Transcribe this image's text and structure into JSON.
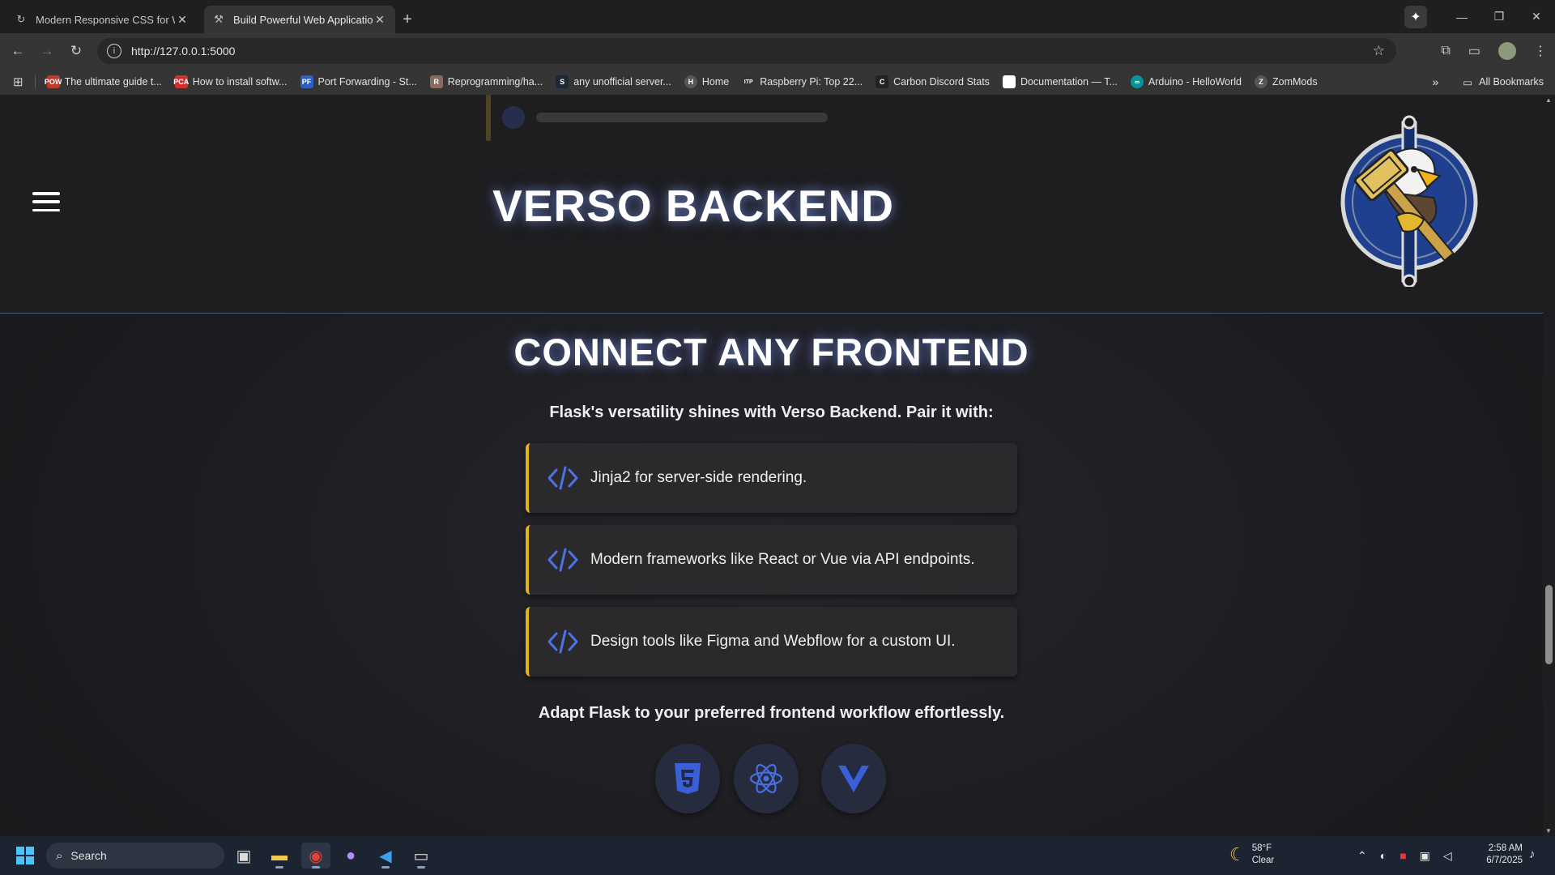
{
  "browser": {
    "tabs": [
      {
        "title": "Modern Responsive CSS for We",
        "active": false
      },
      {
        "title": "Build Powerful Web Application",
        "active": true
      }
    ],
    "new_tab": "+",
    "url": "http://127.0.0.1:5000",
    "bookmarks": [
      {
        "label": "The ultimate guide t...",
        "icon": "POW",
        "color": "#c0392b"
      },
      {
        "label": "How to install softw...",
        "icon": "PCA",
        "color": "#d32f2f"
      },
      {
        "label": "Port Forwarding - St...",
        "icon": "PF",
        "color": "#2c5fbf"
      },
      {
        "label": "Reprogramming/ha...",
        "icon": "R",
        "color": "#8a6a5a"
      },
      {
        "label": "any unofficial server...",
        "icon": "S",
        "color": "#1b2838"
      },
      {
        "label": "Home",
        "icon": "H",
        "color": "#555555"
      },
      {
        "label": "Raspberry Pi: Top 22...",
        "icon": "ITP",
        "color": "#333333"
      },
      {
        "label": "Carbon Discord Stats",
        "icon": "C",
        "color": "#222222"
      },
      {
        "label": "Documentation — T...",
        "icon": "",
        "color": "#ffffff"
      },
      {
        "label": "Arduino - HelloWorld",
        "icon": "∞",
        "color": "#00979c"
      },
      {
        "label": "ZomMods",
        "icon": "Z",
        "color": "#555555"
      }
    ],
    "all_bookmarks": "All Bookmarks"
  },
  "header": {
    "brand": "VERSO BACKEND"
  },
  "section": {
    "title": "CONNECT ANY FRONTEND",
    "lead": "Flask's versatility shines with Verso Backend. Pair it with:",
    "items": [
      "Jinja2 for server-side rendering.",
      "Modern frameworks like React or Vue via API endpoints.",
      "Design tools like Figma and Webflow for a custom UI."
    ],
    "tagline": "Adapt Flask to your preferred frontend workflow effortlessly.",
    "tech_icons": [
      "html5-icon",
      "react-icon",
      "vue-icon"
    ]
  },
  "colors": {
    "accent_gold": "#e3b31a",
    "accent_blue": "#3c5fcf",
    "page_bg": "#1c1c20"
  },
  "taskbar": {
    "search": "Search",
    "weather_temp": "58°F",
    "weather_cond": "Clear",
    "time": "2:58 AM",
    "date": "6/7/2025"
  }
}
